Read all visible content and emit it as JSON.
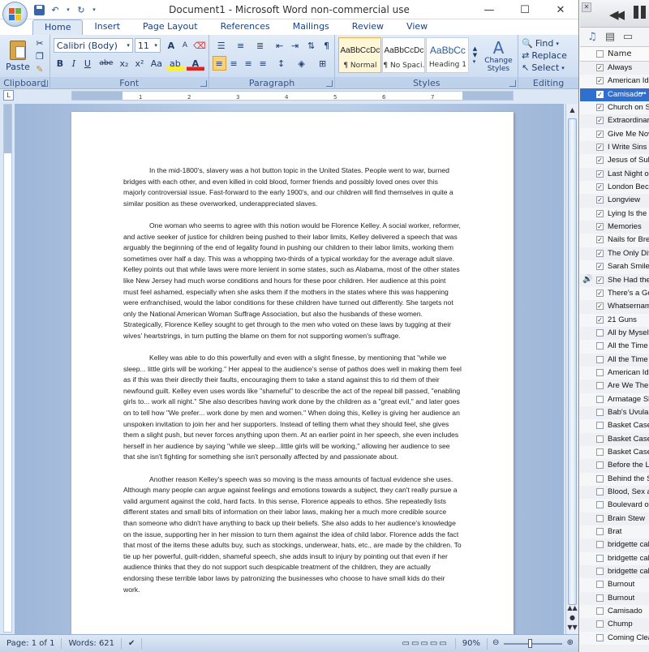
{
  "word": {
    "title": "Document1 - Microsoft Word non-commercial use",
    "tabs": [
      "Home",
      "Insert",
      "Page Layout",
      "References",
      "Mailings",
      "Review",
      "View"
    ],
    "clipboard": {
      "paste": "Paste",
      "label": "Clipboard"
    },
    "font": {
      "name": "Calibri (Body)",
      "size": "11",
      "label": "Font",
      "bold": "B",
      "italic": "I",
      "underline": "U",
      "strike": "abe",
      "sub": "x₂",
      "sup": "x²",
      "clear": "Aa",
      "grow": "A",
      "shrink": "A",
      "case": "Aa",
      "highlight": "ab",
      "color": "A"
    },
    "paragraph": {
      "label": "Paragraph"
    },
    "styles": {
      "label": "Styles",
      "items": [
        {
          "sample": "AaBbCcDc",
          "name": "¶ Normal"
        },
        {
          "sample": "AaBbCcDc",
          "name": "¶ No Spaci..."
        },
        {
          "sample": "AaBbCc",
          "name": "Heading 1"
        }
      ],
      "change": "Change Styles"
    },
    "editing": {
      "label": "Editing",
      "find": "Find",
      "replace": "Replace",
      "select": "Select"
    },
    "ruler_ticks": [
      "1",
      "2",
      "3",
      "4",
      "5",
      "6",
      "7"
    ],
    "paragraphs": [
      "In the mid-1800's, slavery was a hot button topic in the United States.  People went to war, burned bridges with each other, and even killed in cold blood, former friends and possibly loved ones over this majorly controversial issue. Fast-forward to the early 1900's, and our children will find themselves in  quite a similar position as these overworked, underappreciated slaves.",
      "One woman who seems to agree with this notion would be Florence Kelley. A social worker, reformer, and active seeker of justice for children being pushed to their labor limits,  Kelley delivered a speech that was arguably the beginning of the end of legality found in pushing our children to their labor limits, working them sometimes over half a day. This was a whopping two-thirds of a typical workday for the average adult slave. Kelley points out that while laws were more lenient in some states, such as Alabama, most of the other states like New Jersey had much worse conditions and hours for these poor children. Her audience at this point must feel ashamed, especially when she asks them if the mothers in the states where this was happening were enfranchised, would the labor conditions for these children have turned out differently. She targets not only the National American Woman Suffrage Association, but also the husbands of these women. Strategically, Florence Kelley sought to get through to the men who voted on these laws by tugging at their wives' heartstrings, in turn putting the blame on them for not supporting women's suffrage.",
      "Kelley was able to do this powerfully and even with a slight finesse, by mentioning that \"while we sleep... little girls will be working.\"  Her appeal to the audience's sense of pathos does well in making them feel as if this was their directly their faults,  encouraging them to take a stand against this to rid them of their newfound guilt. Kelley even uses words like \"shameful\" to describe the act of the repeal bill passed, \"enabling girls to... work all night.\" She also describes having work done by the children as a \"great evil,\" and later goes on to tell how \"We prefer... work done by men and women.\" When doing this, Kelley is giving her audience an unspoken invitation to join her and her supporters. Instead of telling them what they should feel, she gives them a slight push, but never forces anything upon them. At an earlier point in her speech, she even includes herself in her audience by saying \"while we sleep...little girls will be working,\" allowing her audience to see that she isn't fighting for something she isn't personally affected by and passionate about.",
      "Another reason Kelley's speech was so moving is the mass amounts of factual evidence she uses. Although many people can argue against feelings and emotions towards a subject, they can't really pursue a valid argument against the cold, hard facts. In this sense, Florence appeals to ethos. She repeatedly lists different states and small bits of information on their labor laws, making her a much more credible source than someone who didn't have anything to back up their beliefs. She also adds to her audience's knowledge on the issue, supporting her in her mission to turn them against the idea of child labor.  Florence adds the fact that most of the items these adults buy, such as stockings, underwear, hats, etc., are made by the children. To tie up her powerful, guilt-ridden, shameful speech, she adds insult to injury by pointing out that even if her audience thinks that they do not support such despicable  treatment of the children, they are actually endorsing these terrible labor laws by patronizing the businesses who choose to have small kids do their work."
    ],
    "status": {
      "page": "Page: 1 of 1",
      "words": "Words: 621",
      "zoom": "90%"
    }
  },
  "itunes": {
    "column": "Name",
    "songs": [
      {
        "title": "Always",
        "checked": true
      },
      {
        "title": "American Idio",
        "checked": true
      },
      {
        "title": "Camisado",
        "checked": true,
        "selected": true
      },
      {
        "title": "Church on Su",
        "checked": true
      },
      {
        "title": "Extraordinary",
        "checked": true
      },
      {
        "title": "Give Me Nove",
        "checked": true
      },
      {
        "title": "I Write Sins N",
        "checked": true
      },
      {
        "title": "Jesus of Subu",
        "checked": true
      },
      {
        "title": "Last Night on",
        "checked": true
      },
      {
        "title": "London Beck",
        "checked": true
      },
      {
        "title": "Longview",
        "checked": true
      },
      {
        "title": "Lying Is the M",
        "checked": true
      },
      {
        "title": "Memories",
        "checked": true
      },
      {
        "title": "Nails for Brea",
        "checked": true
      },
      {
        "title": "The Only Diff",
        "checked": true
      },
      {
        "title": "Sarah Smiles",
        "checked": true
      },
      {
        "title": "She Had the W",
        "checked": true,
        "playing": true
      },
      {
        "title": "There's a Goo",
        "checked": true
      },
      {
        "title": "Whatsername",
        "checked": true
      },
      {
        "title": "21 Guns",
        "checked": true
      },
      {
        "title": "All by Myself",
        "checked": false
      },
      {
        "title": "All the Time",
        "checked": false
      },
      {
        "title": "All the Time",
        "checked": false
      },
      {
        "title": "American Idio",
        "checked": false
      },
      {
        "title": "Are We The W",
        "checked": false
      },
      {
        "title": "Armatage Sha",
        "checked": false
      },
      {
        "title": "Bab's Uvula W",
        "checked": false
      },
      {
        "title": "Basket Case",
        "checked": false
      },
      {
        "title": "Basket Case",
        "checked": false
      },
      {
        "title": "Basket Case",
        "checked": false
      },
      {
        "title": "Before the Lo",
        "checked": false
      },
      {
        "title": "Behind the So",
        "checked": false
      },
      {
        "title": "Blood, Sex an",
        "checked": false
      },
      {
        "title": "Boulevard of",
        "checked": false
      },
      {
        "title": "Brain Stew",
        "checked": false
      },
      {
        "title": "Brat",
        "checked": false
      },
      {
        "title": "bridgette call",
        "checked": false
      },
      {
        "title": "bridgette call",
        "checked": false
      },
      {
        "title": "bridgette call",
        "checked": false
      },
      {
        "title": "Burnout",
        "checked": false
      },
      {
        "title": "Burnout",
        "checked": false
      },
      {
        "title": "Camisado",
        "checked": false
      },
      {
        "title": "Chump",
        "checked": false
      },
      {
        "title": "Coming Clear",
        "checked": false
      }
    ]
  }
}
